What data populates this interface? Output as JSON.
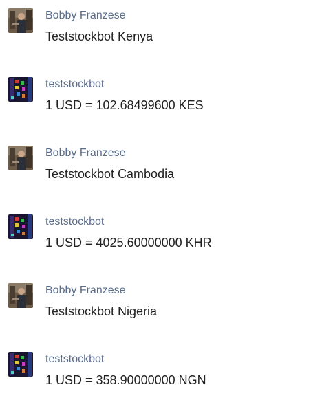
{
  "messages": [
    {
      "sender": "Bobby Franzese",
      "avatar": "user-photo",
      "text": "Teststockbot Kenya"
    },
    {
      "sender": "teststockbot",
      "avatar": "bot-photo",
      "text": "1 USD = 102.68499600 KES"
    },
    {
      "sender": "Bobby Franzese",
      "avatar": "user-photo",
      "text": "Teststockbot Cambodia"
    },
    {
      "sender": "teststockbot",
      "avatar": "bot-photo",
      "text": "1 USD = 4025.60000000 KHR"
    },
    {
      "sender": "Bobby Franzese",
      "avatar": "user-photo",
      "text": "Teststockbot Nigeria"
    },
    {
      "sender": "teststockbot",
      "avatar": "bot-photo",
      "text": "1 USD = 358.90000000 NGN"
    }
  ]
}
